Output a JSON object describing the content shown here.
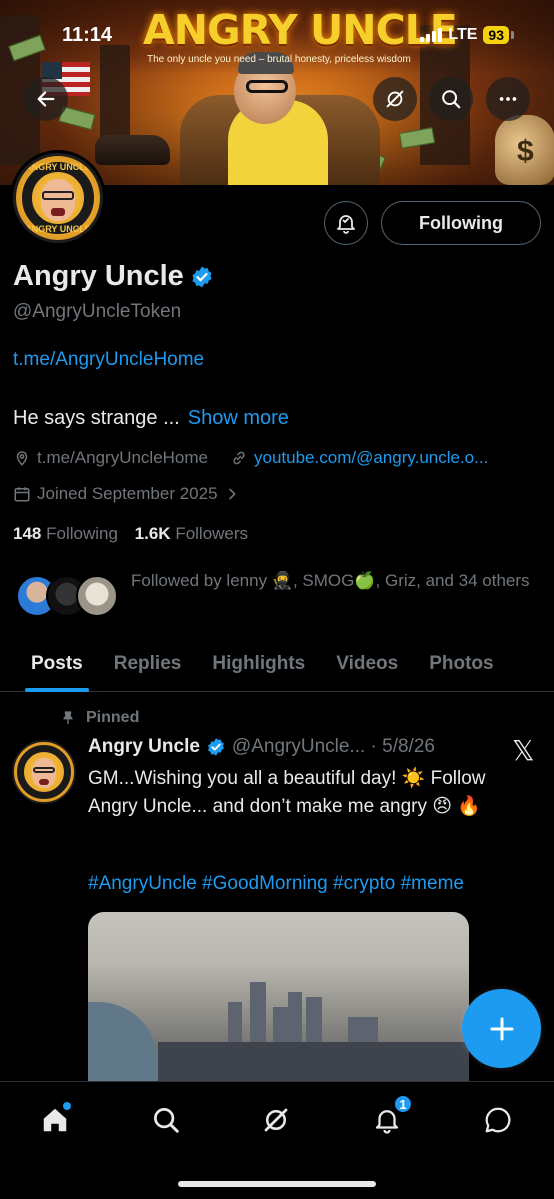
{
  "status": {
    "time": "11:14",
    "network": "LTE",
    "battery": "93"
  },
  "banner": {
    "title": "ANGRY UNCLE",
    "tagline": "The only uncle you need – brutal honesty, priceless wisdom"
  },
  "avatar_ring": {
    "top": "ANGRY UNCLE",
    "bottom": "ANGRY UNCLE"
  },
  "header": {
    "following_label": "Following"
  },
  "profile": {
    "display_name": "Angry Uncle",
    "handle": "@AngryUncleToken",
    "bio_link": "t.me/AngryUncleHome",
    "bio_text": "He says strange ...",
    "show_more": "Show more",
    "location": "t.me/AngryUncleHome",
    "website": "youtube.com/@angry.uncle.o...",
    "joined": "Joined September 2025",
    "following_count": "148",
    "following_label": "Following",
    "followers_count": "1.6K",
    "followers_label": "Followers",
    "followed_by": "Followed by lenny 🥷, SMOG🍏, Griz, and 34 others"
  },
  "tabs": [
    "Posts",
    "Replies",
    "Highlights",
    "Videos",
    "Photos"
  ],
  "post": {
    "pinned_label": "Pinned",
    "name": "Angry Uncle",
    "handle_date": "@AngryUncle... · 5/8/26",
    "text": "GM...Wishing you all a beautiful day! ☀️ Follow Angry Uncle... and don’t make me angry 😠 🔥",
    "hashtags": "#AngryUncle #GoodMorning #crypto #meme",
    "x_glyph": "𝕏"
  },
  "nav": {
    "notifications_badge": "1"
  },
  "icons": [
    "back-arrow-icon",
    "grok-icon",
    "search-icon",
    "more-icon",
    "notify-icon",
    "verified-badge-icon",
    "location-icon",
    "link-icon",
    "calendar-icon",
    "chevron-right-icon",
    "pin-icon",
    "plus-icon",
    "home-icon",
    "notifications-icon",
    "messages-icon"
  ],
  "colors": {
    "accent": "#1d9bf0",
    "background": "#000000",
    "text": "#e7e9ea",
    "muted": "#71767b",
    "border": "#536471"
  }
}
